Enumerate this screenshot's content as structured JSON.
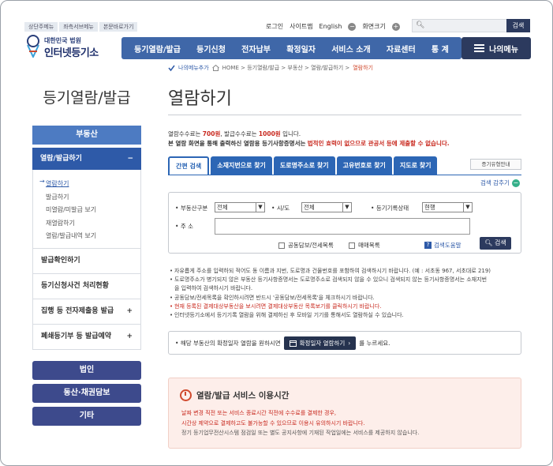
{
  "header": {
    "skip_links": [
      "상단주메뉴",
      "좌측서브메뉴",
      "본문바로가기"
    ],
    "logo_line1": "대한민국 법원",
    "logo_line2": "인터넷등기소",
    "util": {
      "login": "로그인",
      "sitemap": "사이트맵",
      "english": "English",
      "zoom_label": "화면크기",
      "minus": "−",
      "plus": "+"
    },
    "search": {
      "button": "검색",
      "placeholder": ""
    },
    "gnb": [
      "등기열람/발급",
      "등기신청",
      "전자납부",
      "확정일자",
      "서비스 소개",
      "자료센터",
      "통 계"
    ],
    "my_menu": "나의메뉴"
  },
  "sidebar": {
    "title": "등기열람/발급",
    "section_head": "부동산",
    "selected": {
      "label": "열람/발급하기",
      "toggle": "−"
    },
    "sub_items": [
      "열람하기",
      "발급하기",
      "미열람/미발급 보기",
      "재열람하기",
      "열람/발급내역 보기"
    ],
    "items": [
      {
        "label": "발급확인하기",
        "toggle": ""
      },
      {
        "label": "등기신청사건 처리현황",
        "toggle": ""
      },
      {
        "label": "집행 등 전자제출용 발급",
        "toggle": "+"
      },
      {
        "label": "폐쇄등기부 등 발급예약",
        "toggle": "+"
      }
    ],
    "pills": [
      "법인",
      "동산·채권담보",
      "기타"
    ]
  },
  "breadcrumb": {
    "favorite": "나의메뉴추가",
    "path": "HOME > 등기열람/발급 > 부동산 > 열람/발급하기 >",
    "current": "열람하기"
  },
  "page_title": "열람하기",
  "fee": {
    "p1": "열람수수료는",
    "v1": "700원",
    "p2": ", 발급수수료는",
    "v2": "1000원",
    "p3": "입니다.",
    "line2a": "본 열람 화면을 통해 출력하신 열람용 등기사항증명서는",
    "line2b": "법적인 효력이 없으므로 관공서 등에 제출할 수 없습니다."
  },
  "tabs": [
    "간편 검색",
    "소재지번으로 찾기",
    "도로명주소로 찾기",
    "고유번호로 찾기",
    "지도로 찾기"
  ],
  "history_button": "증기유형안내",
  "advanced_search": "검색 감추기",
  "form": {
    "property_type_label": "부동산구분",
    "property_type_value": "전체",
    "region_label": "시/도",
    "region_value": "전체",
    "status_label": "등기기록상태",
    "status_value": "현행",
    "address_label": "주 소",
    "check1": "공동담보/전세목록",
    "check2": "매매목록",
    "help": "검색도움말",
    "search_button": "검색"
  },
  "notes": [
    "자유롭게 주소를 입력하되 적어도 동 이름과 지번, 도로명과 건물번호를 포함하여 검색하시기 바랍니다. (예 : 서초동 967, 서초대로 219)",
    "도로명주소가 병기되지 않은 부동산 등기사항증명서는 도로명주소로 검색되지 않을 수 있으니 검색되지 않는 등기사항증명서는 소재지번",
    "을 입력하여 검색하시기 바랍니다.",
    "공동담보/전세목록을 확인하시려면 반드시 '공동담보/전세목록'을 체크하시기 바랍니다.",
    "현재 등록된 결제대상부동산을 보시려면 결제대상부동산 목록보기를 클릭하시기 바랍니다.",
    "인터넷등기소에서 등기기록 열람을 위해 결제하신 후 모바일 기기를 통해서도 열람하실 수 있습니다."
  ],
  "date_box": {
    "pre": "해당 부동산의 확정일자 열람을 원하시면",
    "button": "확정일자 열람하기",
    "post": "를 누르세요."
  },
  "notice": {
    "title": "열람/발급 서비스 이용시간",
    "line1": "날짜 변경 직전 또는 서비스 종료시간 직전에 수수료를 결제한 경우,",
    "line2": "시간상 제약으로 결제하고도 불가능할 수 있으므로 이용시 유의하시기 바랍니다.",
    "line3": "정기 등기업무전산시스템 점검일 또는 별도 공지사항에 기재된 작업일에는 서비스를 제공하지 않습니다."
  }
}
